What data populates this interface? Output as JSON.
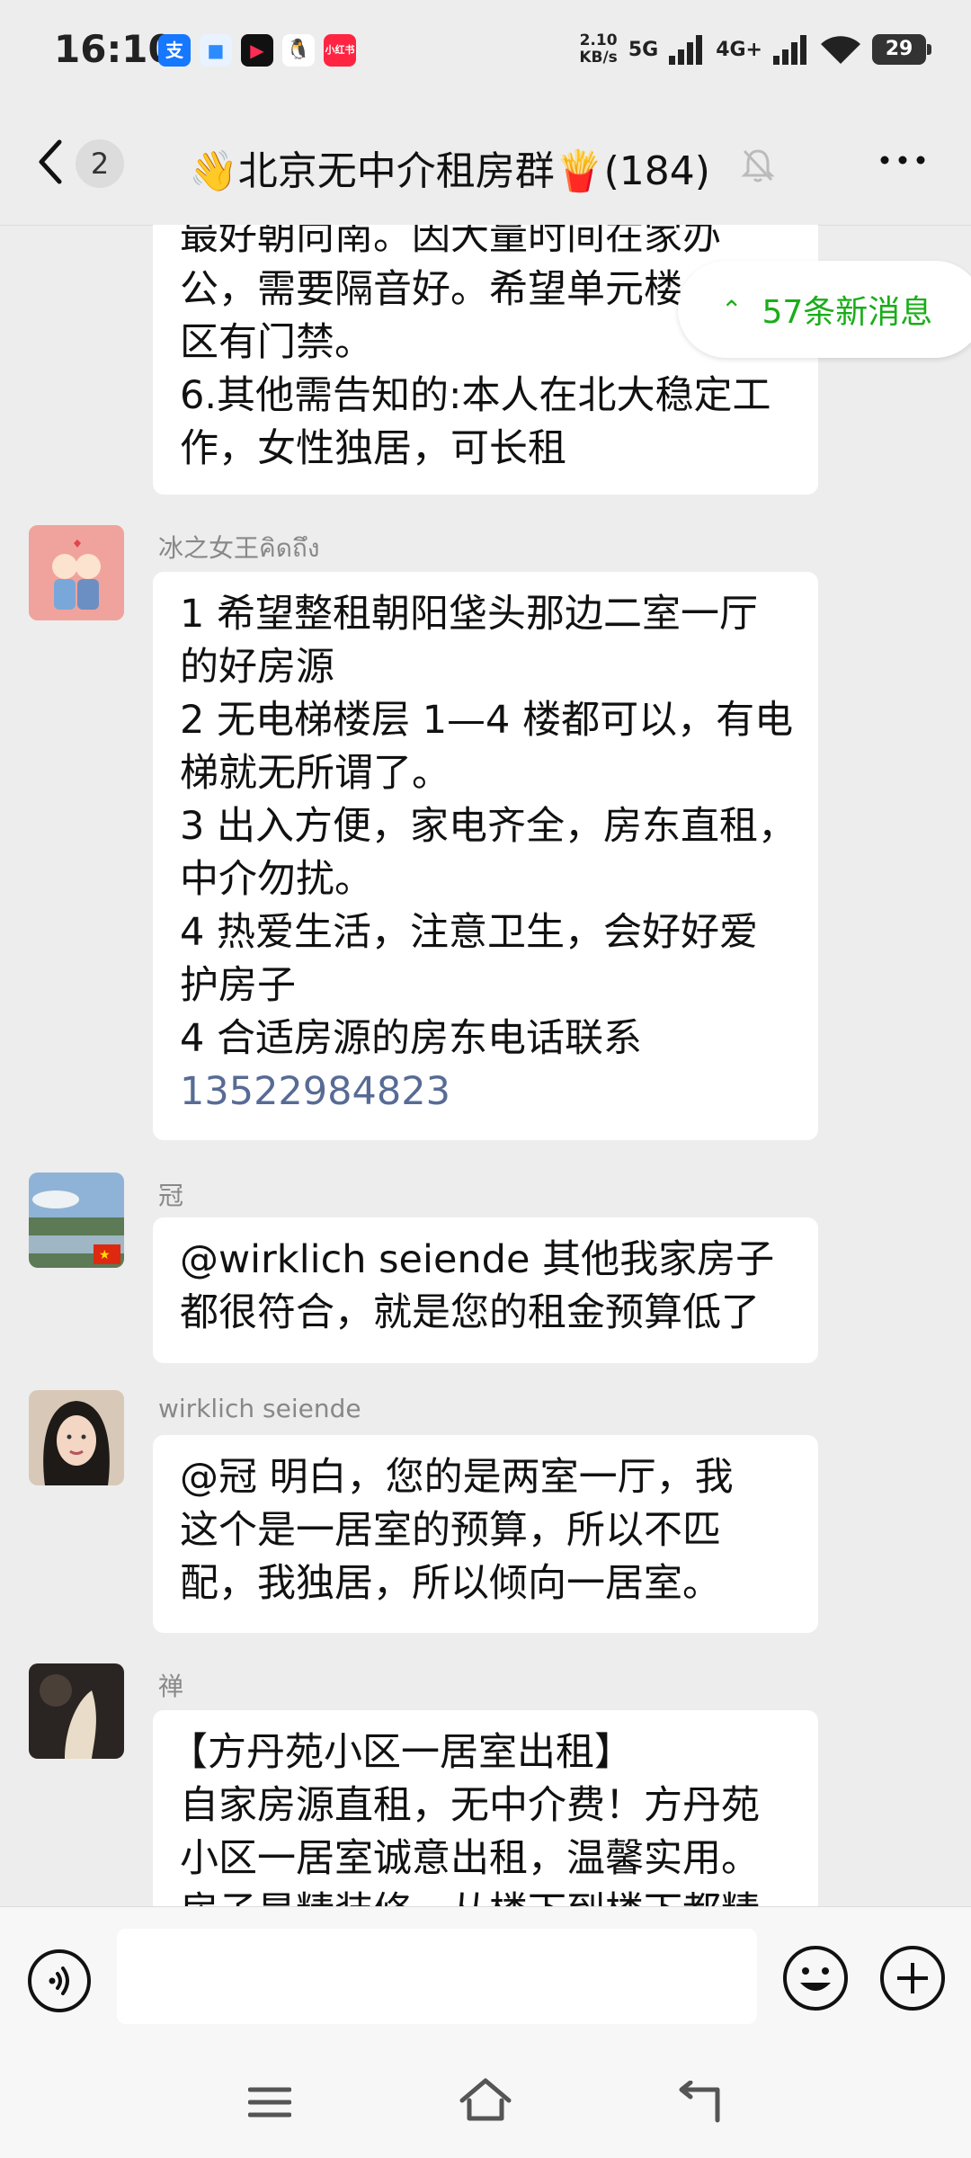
{
  "status_bar": {
    "time": "16:10",
    "notification_icons": [
      {
        "name": "alipay-icon",
        "glyph": "支",
        "color": "#1677ff"
      },
      {
        "name": "app-icon",
        "glyph": "■",
        "color": "#2a8cff"
      },
      {
        "name": "video-app-icon",
        "glyph": "▶",
        "color": "#e0002a"
      },
      {
        "name": "qq-icon",
        "glyph": "🐧",
        "color": "#ffffff"
      },
      {
        "name": "xiaohongshu-icon",
        "glyph": "小红书",
        "color": "#ff2442"
      }
    ],
    "net_speed_value": "2.10",
    "net_speed_unit": "KB/s",
    "signal_1": "5G",
    "signal_2": "4G+",
    "battery": "29"
  },
  "header": {
    "unread_count": "2",
    "title": "👋北京无中介租房群🍟(184)"
  },
  "new_messages_pill": "57条新消息",
  "messages": [
    {
      "lines": [
        "最好朝向南。因大量时间在家办",
        "公，需要隔音好。希望单元楼",
        "区有门禁。",
        "6.其他需告知的:本人在北大稳定工",
        "作，女性独居，可长租"
      ]
    },
    {
      "sender": "冰之女王คิดถึง",
      "lines": [
        "1 希望整租朝阳垡头那边二室一厅",
        "的好房源",
        "2 无电梯楼层 1—4 楼都可以，有电",
        "梯就无所谓了。",
        "3 出入方便，家电齐全，房东直租，",
        "中介勿扰。",
        "4 热爱生活，注意卫生，会好好爱",
        "护房子",
        "4 合适房源的房东电话联系"
      ],
      "phone": "13522984823"
    },
    {
      "sender": "冠",
      "lines": [
        "@wirklich seiende  其他我家房子",
        "都很符合，就是您的租金预算低了"
      ]
    },
    {
      "sender": "wirklich seiende",
      "lines": [
        "@冠  明白，您的是两室一厅，我",
        "这个是一居室的预算，所以不匹",
        "配，我独居，所以倾向一居室。"
      ]
    },
    {
      "sender": "禅",
      "lines": [
        "【方丹苑小区一居室出租】",
        "自家房源直租，无中介费！方丹苑",
        "小区一居室诚意出租，温馨实用。",
        "房子是精装修，从楼下到楼下都精"
      ]
    }
  ]
}
